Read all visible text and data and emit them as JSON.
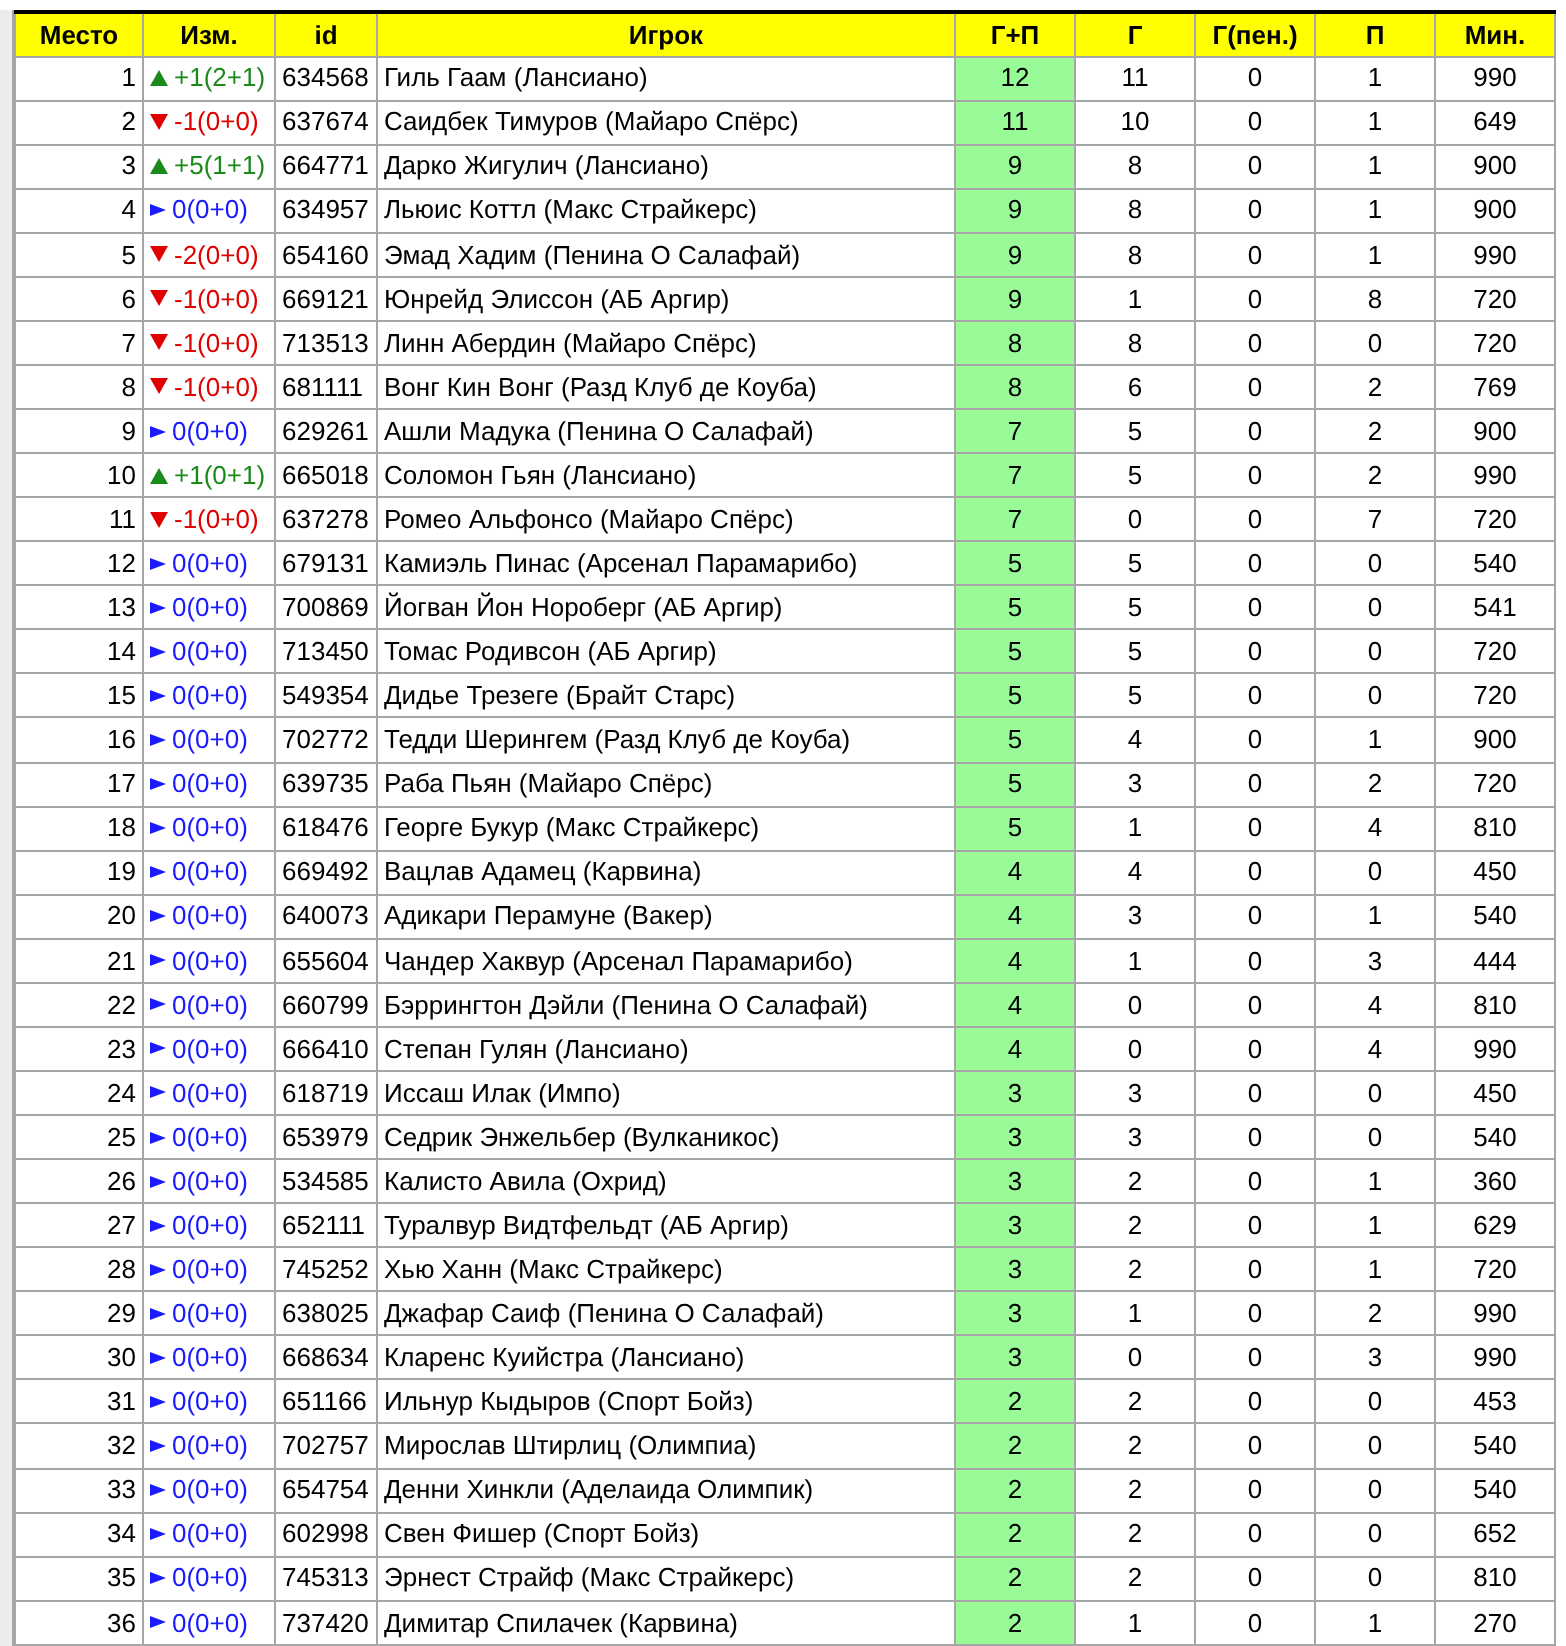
{
  "columns": [
    "Место",
    "Изм.",
    "id",
    "Игрок",
    "Г+П",
    "Г",
    "Г(пен.)",
    "П",
    "Мин."
  ],
  "rows": [
    {
      "place": "1",
      "kind": "up",
      "change": "+1(2+1)",
      "id": "634568",
      "player": "Гиль Гаам (Лансиано)",
      "gp": "12",
      "g": "11",
      "gpen": "0",
      "p": "1",
      "min": "990"
    },
    {
      "place": "2",
      "kind": "down",
      "change": "-1(0+0)",
      "id": "637674",
      "player": "Саидбек Тимуров (Майаро Спёрс)",
      "gp": "11",
      "g": "10",
      "gpen": "0",
      "p": "1",
      "min": "649"
    },
    {
      "place": "3",
      "kind": "up",
      "change": "+5(1+1)",
      "id": "664771",
      "player": "Дарко Жигулич (Лансиано)",
      "gp": "9",
      "g": "8",
      "gpen": "0",
      "p": "1",
      "min": "900"
    },
    {
      "place": "4",
      "kind": "same",
      "change": "0(0+0)",
      "id": "634957",
      "player": "Льюис Коттл (Макс Страйкерс)",
      "gp": "9",
      "g": "8",
      "gpen": "0",
      "p": "1",
      "min": "900"
    },
    {
      "place": "5",
      "kind": "down",
      "change": "-2(0+0)",
      "id": "654160",
      "player": "Эмад Хадим (Пенина О Салафай)",
      "gp": "9",
      "g": "8",
      "gpen": "0",
      "p": "1",
      "min": "990"
    },
    {
      "place": "6",
      "kind": "down",
      "change": "-1(0+0)",
      "id": "669121",
      "player": "Юнрейд Элиссон (АБ Аргир)",
      "gp": "9",
      "g": "1",
      "gpen": "0",
      "p": "8",
      "min": "720"
    },
    {
      "place": "7",
      "kind": "down",
      "change": "-1(0+0)",
      "id": "713513",
      "player": "Линн Абердин (Майаро Спёрс)",
      "gp": "8",
      "g": "8",
      "gpen": "0",
      "p": "0",
      "min": "720"
    },
    {
      "place": "8",
      "kind": "down",
      "change": "-1(0+0)",
      "id": "681111",
      "player": "Вонг Кин Вонг (Разд Клуб де Коуба)",
      "gp": "8",
      "g": "6",
      "gpen": "0",
      "p": "2",
      "min": "769"
    },
    {
      "place": "9",
      "kind": "same",
      "change": "0(0+0)",
      "id": "629261",
      "player": "Ашли Мадука (Пенина О Салафай)",
      "gp": "7",
      "g": "5",
      "gpen": "0",
      "p": "2",
      "min": "900"
    },
    {
      "place": "10",
      "kind": "up",
      "change": "+1(0+1)",
      "id": "665018",
      "player": "Соломон Гьян (Лансиано)",
      "gp": "7",
      "g": "5",
      "gpen": "0",
      "p": "2",
      "min": "990"
    },
    {
      "place": "11",
      "kind": "down",
      "change": "-1(0+0)",
      "id": "637278",
      "player": "Ромео Альфонсо (Майаро Спёрс)",
      "gp": "7",
      "g": "0",
      "gpen": "0",
      "p": "7",
      "min": "720"
    },
    {
      "place": "12",
      "kind": "same",
      "change": "0(0+0)",
      "id": "679131",
      "player": "Камиэль Пинас (Арсенал Парамарибо)",
      "gp": "5",
      "g": "5",
      "gpen": "0",
      "p": "0",
      "min": "540"
    },
    {
      "place": "13",
      "kind": "same",
      "change": "0(0+0)",
      "id": "700869",
      "player": "Йогван Йон Нороберг (АБ Аргир)",
      "gp": "5",
      "g": "5",
      "gpen": "0",
      "p": "0",
      "min": "541"
    },
    {
      "place": "14",
      "kind": "same",
      "change": "0(0+0)",
      "id": "713450",
      "player": "Томас Родивсон (АБ Аргир)",
      "gp": "5",
      "g": "5",
      "gpen": "0",
      "p": "0",
      "min": "720"
    },
    {
      "place": "15",
      "kind": "same",
      "change": "0(0+0)",
      "id": "549354",
      "player": "Дидье Трезеге (Брайт Старс)",
      "gp": "5",
      "g": "5",
      "gpen": "0",
      "p": "0",
      "min": "720"
    },
    {
      "place": "16",
      "kind": "same",
      "change": "0(0+0)",
      "id": "702772",
      "player": "Тедди Шерингем (Разд Клуб де Коуба)",
      "gp": "5",
      "g": "4",
      "gpen": "0",
      "p": "1",
      "min": "900"
    },
    {
      "place": "17",
      "kind": "same",
      "change": "0(0+0)",
      "id": "639735",
      "player": "Раба Пьян (Майаро Спёрс)",
      "gp": "5",
      "g": "3",
      "gpen": "0",
      "p": "2",
      "min": "720"
    },
    {
      "place": "18",
      "kind": "same",
      "change": "0(0+0)",
      "id": "618476",
      "player": "Георге Букур (Макс Страйкерс)",
      "gp": "5",
      "g": "1",
      "gpen": "0",
      "p": "4",
      "min": "810"
    },
    {
      "place": "19",
      "kind": "same",
      "change": "0(0+0)",
      "id": "669492",
      "player": "Вацлав Адамец (Карвина)",
      "gp": "4",
      "g": "4",
      "gpen": "0",
      "p": "0",
      "min": "450"
    },
    {
      "place": "20",
      "kind": "same",
      "change": "0(0+0)",
      "id": "640073",
      "player": "Адикари Перамуне (Вакер)",
      "gp": "4",
      "g": "3",
      "gpen": "0",
      "p": "1",
      "min": "540"
    },
    {
      "place": "21",
      "kind": "same",
      "change": "0(0+0)",
      "id": "655604",
      "player": "Чандер Хаквур (Арсенал Парамарибо)",
      "gp": "4",
      "g": "1",
      "gpen": "0",
      "p": "3",
      "min": "444"
    },
    {
      "place": "22",
      "kind": "same",
      "change": "0(0+0)",
      "id": "660799",
      "player": "Бэррингтон Дэйли (Пенина О Салафай)",
      "gp": "4",
      "g": "0",
      "gpen": "0",
      "p": "4",
      "min": "810"
    },
    {
      "place": "23",
      "kind": "same",
      "change": "0(0+0)",
      "id": "666410",
      "player": "Степан Гулян (Лансиано)",
      "gp": "4",
      "g": "0",
      "gpen": "0",
      "p": "4",
      "min": "990"
    },
    {
      "place": "24",
      "kind": "same",
      "change": "0(0+0)",
      "id": "618719",
      "player": "Иссаш Илак (Импо)",
      "gp": "3",
      "g": "3",
      "gpen": "0",
      "p": "0",
      "min": "450"
    },
    {
      "place": "25",
      "kind": "same",
      "change": "0(0+0)",
      "id": "653979",
      "player": "Седрик Энжельбер (Вулканикос)",
      "gp": "3",
      "g": "3",
      "gpen": "0",
      "p": "0",
      "min": "540"
    },
    {
      "place": "26",
      "kind": "same",
      "change": "0(0+0)",
      "id": "534585",
      "player": "Калисто Авила (Охрид)",
      "gp": "3",
      "g": "2",
      "gpen": "0",
      "p": "1",
      "min": "360"
    },
    {
      "place": "27",
      "kind": "same",
      "change": "0(0+0)",
      "id": "652111",
      "player": "Туралвур Видтфельдт (АБ Аргир)",
      "gp": "3",
      "g": "2",
      "gpen": "0",
      "p": "1",
      "min": "629"
    },
    {
      "place": "28",
      "kind": "same",
      "change": "0(0+0)",
      "id": "745252",
      "player": "Хью Ханн (Макс Страйкерс)",
      "gp": "3",
      "g": "2",
      "gpen": "0",
      "p": "1",
      "min": "720"
    },
    {
      "place": "29",
      "kind": "same",
      "change": "0(0+0)",
      "id": "638025",
      "player": "Джафар Саиф (Пенина О Салафай)",
      "gp": "3",
      "g": "1",
      "gpen": "0",
      "p": "2",
      "min": "990"
    },
    {
      "place": "30",
      "kind": "same",
      "change": "0(0+0)",
      "id": "668634",
      "player": "Кларенс Куийстра (Лансиано)",
      "gp": "3",
      "g": "0",
      "gpen": "0",
      "p": "3",
      "min": "990"
    },
    {
      "place": "31",
      "kind": "same",
      "change": "0(0+0)",
      "id": "651166",
      "player": "Ильнур Кыдыров (Спорт Бойз)",
      "gp": "2",
      "g": "2",
      "gpen": "0",
      "p": "0",
      "min": "453"
    },
    {
      "place": "32",
      "kind": "same",
      "change": "0(0+0)",
      "id": "702757",
      "player": "Мирослав Штирлиц (Олимпиа)",
      "gp": "2",
      "g": "2",
      "gpen": "0",
      "p": "0",
      "min": "540"
    },
    {
      "place": "33",
      "kind": "same",
      "change": "0(0+0)",
      "id": "654754",
      "player": "Денни Хинкли (Аделаида Олимпик)",
      "gp": "2",
      "g": "2",
      "gpen": "0",
      "p": "0",
      "min": "540"
    },
    {
      "place": "34",
      "kind": "same",
      "change": "0(0+0)",
      "id": "602998",
      "player": "Свен Фишер (Спорт Бойз)",
      "gp": "2",
      "g": "2",
      "gpen": "0",
      "p": "0",
      "min": "652"
    },
    {
      "place": "35",
      "kind": "same",
      "change": "0(0+0)",
      "id": "745313",
      "player": "Эрнест Страйф (Макс Страйкерс)",
      "gp": "2",
      "g": "2",
      "gpen": "0",
      "p": "0",
      "min": "810"
    },
    {
      "place": "36",
      "kind": "same",
      "change": "0(0+0)",
      "id": "737420",
      "player": "Димитар Спилачек (Карвина)",
      "gp": "2",
      "g": "1",
      "gpen": "0",
      "p": "1",
      "min": "270"
    }
  ]
}
